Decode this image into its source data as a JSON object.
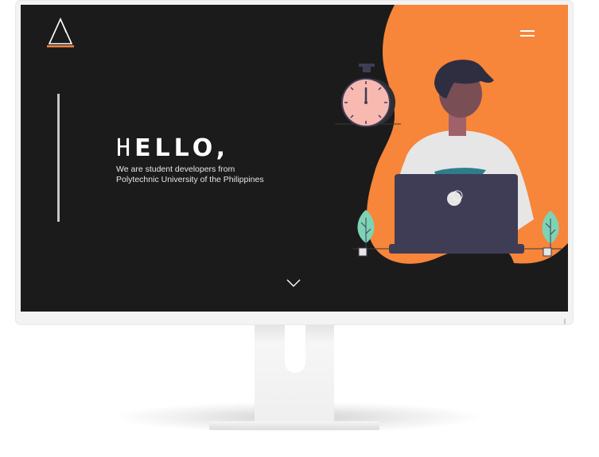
{
  "header": {
    "logo_icon": "triangle-logo-icon",
    "menu_icon": "hamburger-menu-icon"
  },
  "hero": {
    "title_first_letter": "H",
    "title_rest": "ELLO",
    "title_punct": ",",
    "subtitle_line1": "We are student developers from",
    "subtitle_line2": "Polytechnic University of the Philippines",
    "scroll_icon": "chevron-down-icon"
  },
  "illustration": {
    "subject": "developer-at-laptop",
    "elements": [
      "stopwatch-icon",
      "laptop-icon",
      "plant-icon"
    ]
  },
  "colors": {
    "screen_bg": "#1b1b1c",
    "accent_orange": "#f7853a",
    "text_white": "#ffffff",
    "plant_green": "#7ed3b5",
    "laptop_dark": "#3f3d56",
    "clock_pink": "#f8b9b1",
    "bezel": "#f3f3f3"
  }
}
